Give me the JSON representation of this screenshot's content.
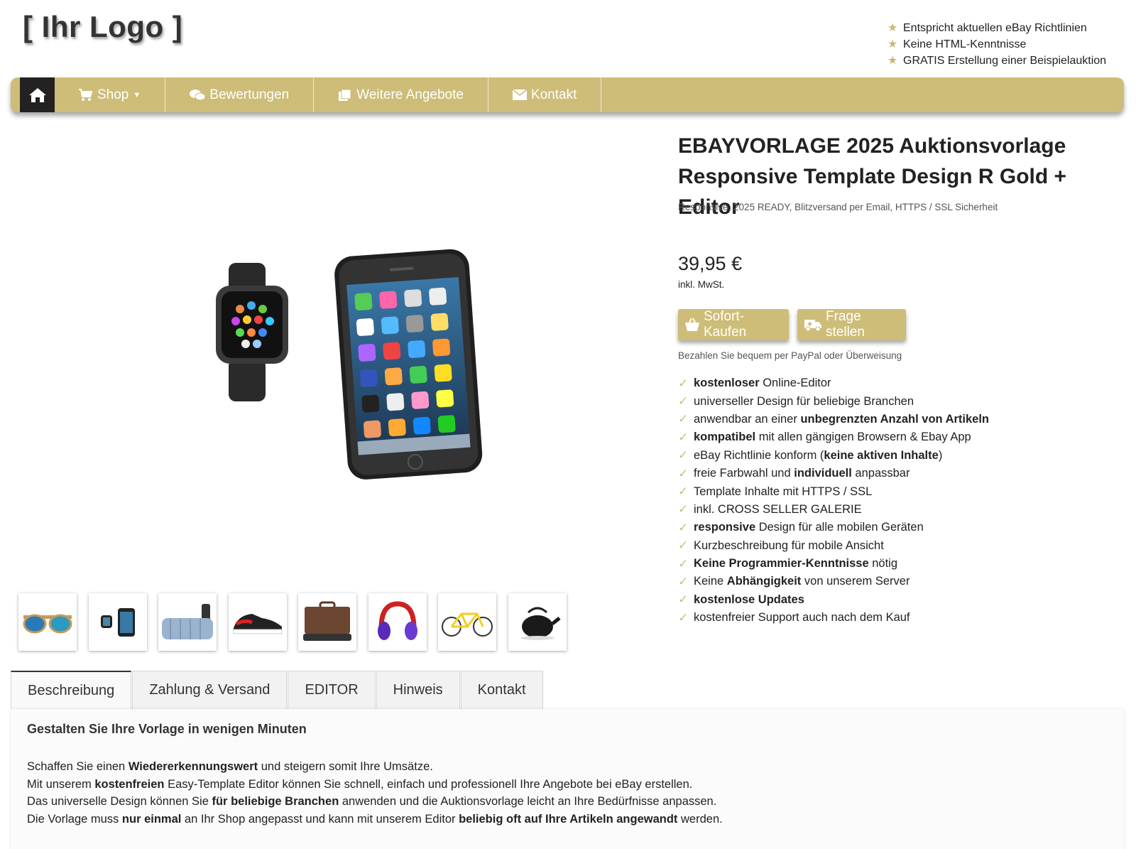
{
  "header": {
    "logo": "[ Ihr Logo ]",
    "usps": [
      "Entspricht aktuellen eBay Richtlinien",
      "Keine HTML-Kenntnisse",
      "GRATIS Erstellung einer Beispielauktion"
    ]
  },
  "nav": {
    "home_icon": "home-icon",
    "items": [
      {
        "label": "Shop",
        "icon": "cart-icon"
      },
      {
        "label": "Bewertungen",
        "icon": "comments-icon"
      },
      {
        "label": "Weitere Angebote",
        "icon": "copy-icon"
      },
      {
        "label": "Kontakt",
        "icon": "envelope-icon"
      }
    ]
  },
  "product": {
    "title_line1": "EBAYVORLAGE 2025 Auktionsvorlage",
    "title_line2": "Responsive Template Design R Gold + Editor",
    "subtitle": "Responsive, 2025 READY, Blitzversand per Email, HTTPS / SSL Sicherheit",
    "price": "39,95 €",
    "vat": "inkl. MwSt.",
    "buy_label": "Sofort-Kaufen",
    "ask_label": "Frage stellen",
    "pay_note": "Bezahlen Sie bequem per PayPal oder Überweisung"
  },
  "features": [
    {
      "bold": "kostenloser",
      "rest": " Online-Editor"
    },
    {
      "pre": "universeller Design für beliebige Branchen"
    },
    {
      "pre": "anwendbar an einer ",
      "bold": "unbegrenzten Anzahl von Artikeln"
    },
    {
      "bold": "kompatibel",
      "rest": " mit allen gängigen Browsern & Ebay App"
    },
    {
      "pre": "eBay Richtlinie konform (",
      "bold": "keine aktiven Inhalte",
      "rest": ")"
    },
    {
      "pre": "freie Farbwahl und ",
      "bold": "individuell",
      "rest": " anpassbar"
    },
    {
      "pre": "Template Inhalte mit HTTPS / SSL"
    },
    {
      "pre": "inkl. CROSS SELLER GALERIE"
    },
    {
      "bold": "responsive",
      "rest": " Design für alle mobilen Geräten"
    },
    {
      "pre": "Kurzbeschreibung für mobile Ansicht"
    },
    {
      "bold": "Keine Programmier-Kenntnisse",
      "rest": " nötig"
    },
    {
      "pre": "Keine ",
      "bold": "Abhängigkeit",
      "rest": " von unserem Server"
    },
    {
      "bold": "kostenlose Updates"
    },
    {
      "pre": "kostenfreier Support auch nach dem Kauf"
    }
  ],
  "thumbnails": [
    "sunglasses",
    "watch-and-phone",
    "towels",
    "sneaker",
    "briefcase",
    "headphones",
    "bicycle",
    "teapot"
  ],
  "tabs": [
    "Beschreibung",
    "Zahlung & Versand",
    "EDITOR",
    "Hinweis",
    "Kontakt"
  ],
  "description": {
    "heading": "Gestalten Sie Ihre Vorlage in wenigen Minuten",
    "lines": [
      [
        {
          "t": "Schaffen Sie einen "
        },
        {
          "b": "Wiedererkennungswert"
        },
        {
          "t": " und steigern somit Ihre Umsätze."
        }
      ],
      [
        {
          "t": "Mit unserem "
        },
        {
          "b": "kostenfreien"
        },
        {
          "t": " Easy-Template Editor können Sie schnell, einfach und professionell Ihre Angebote bei eBay erstellen."
        }
      ],
      [
        {
          "t": "Das universelle Design können Sie "
        },
        {
          "b": "für beliebige Branchen"
        },
        {
          "t": " anwenden und die Auktionsvorlage leicht an Ihre Bedürfnisse anpassen."
        }
      ],
      [
        {
          "t": "Die Vorlage muss "
        },
        {
          "b": "nur einmal"
        },
        {
          "t": " an Ihr Shop angepasst und kann mit unserem Editor "
        },
        {
          "b": "beliebig oft auf Ihre Artikeln angewandt"
        },
        {
          "t": " werden."
        }
      ]
    ]
  },
  "colors": {
    "accent": "#cdbd78",
    "home_bg": "#222222"
  }
}
